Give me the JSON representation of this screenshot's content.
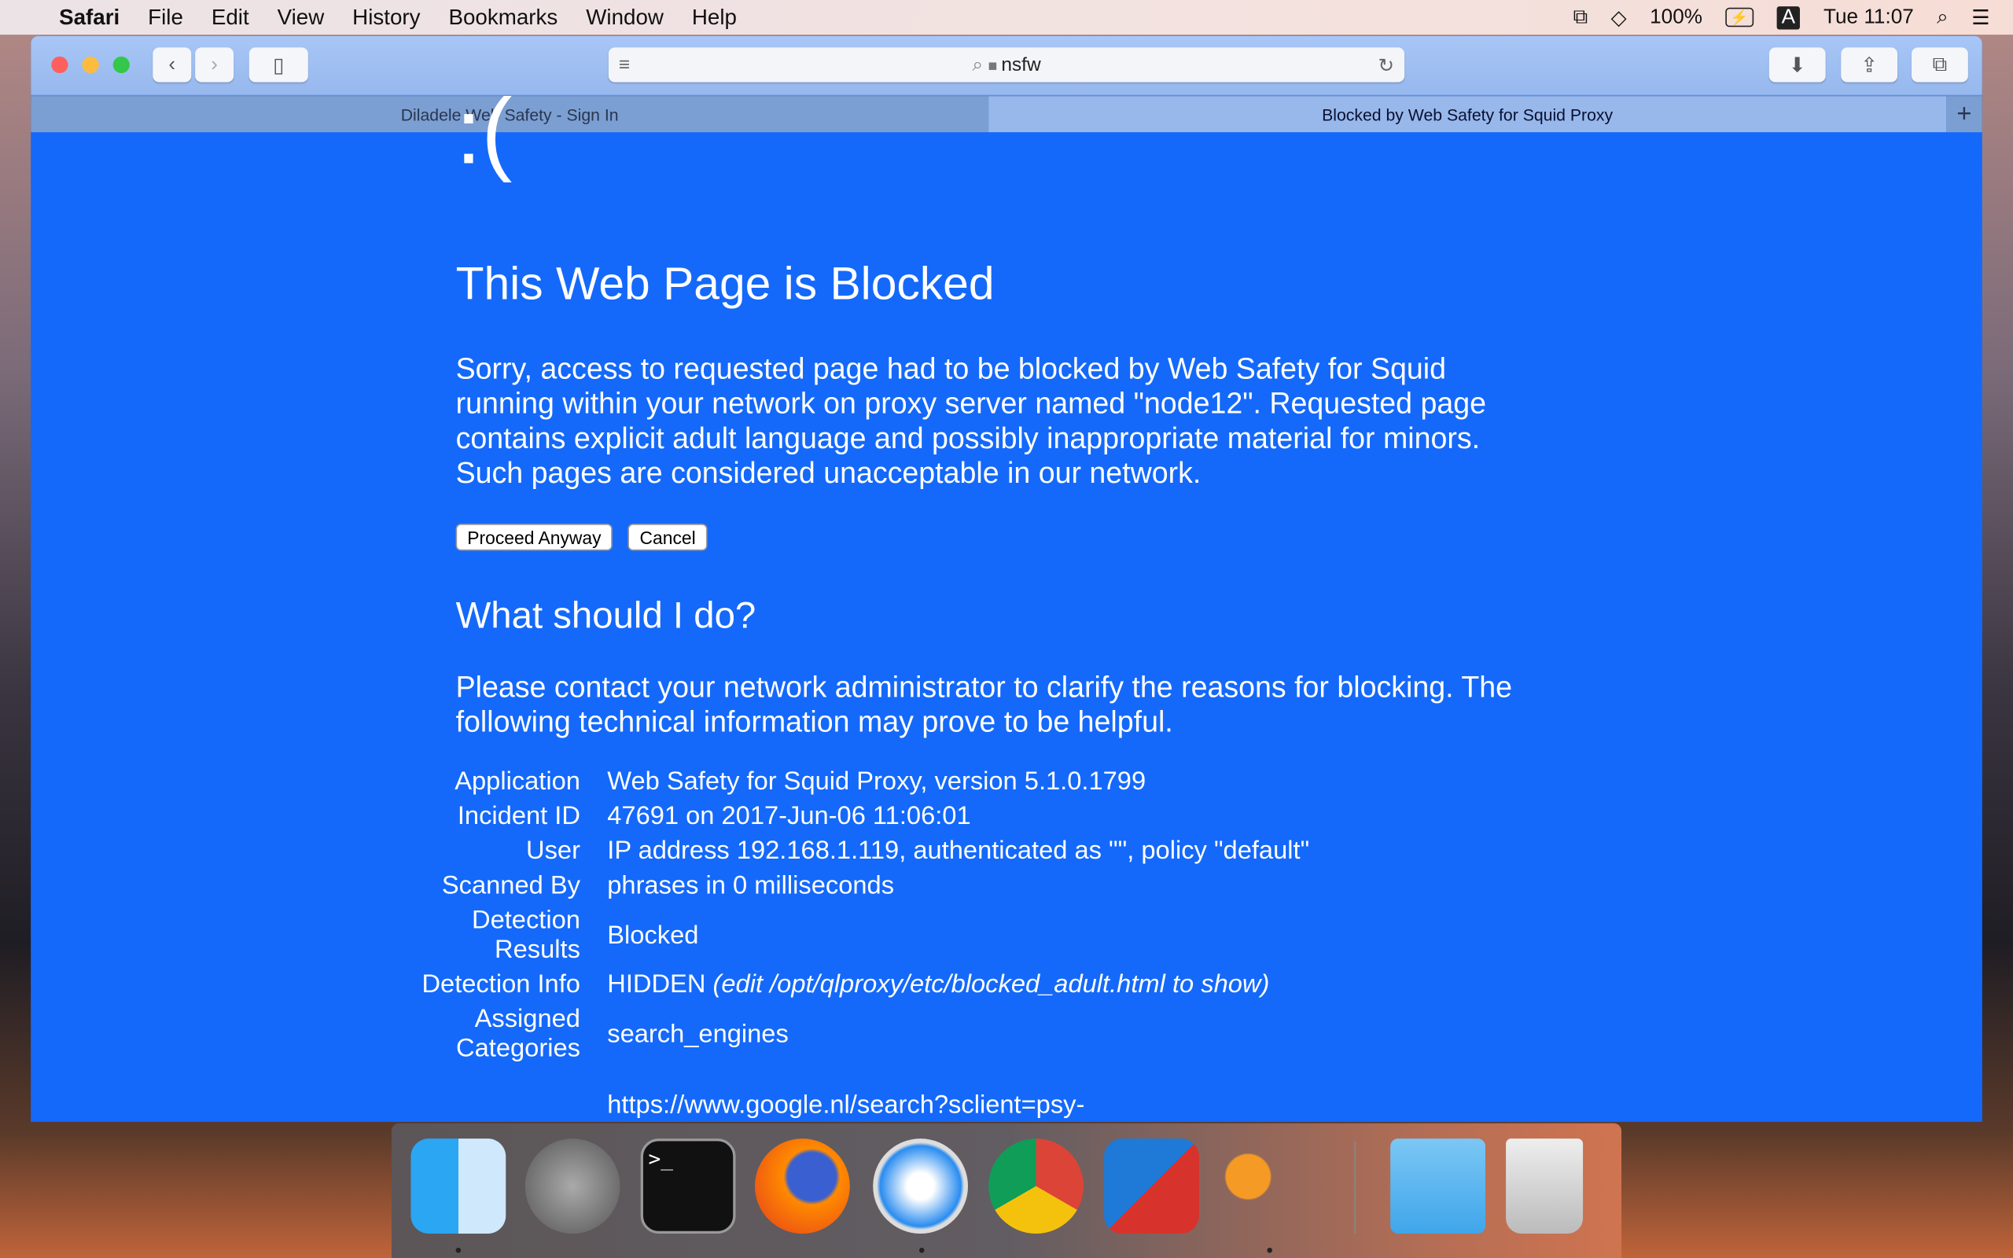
{
  "menubar": {
    "app": "Safari",
    "items": [
      "File",
      "Edit",
      "View",
      "History",
      "Bookmarks",
      "Window",
      "Help"
    ],
    "battery": "100%",
    "input_source": "A",
    "clock": "Tue 11:07"
  },
  "browser": {
    "url": "nsfw",
    "tabs": [
      {
        "title": "Diladele Web Safety - Sign In",
        "active": false
      },
      {
        "title": "Blocked by Web Safety for Squid Proxy",
        "active": true
      }
    ],
    "new_tab": "+"
  },
  "page": {
    "face": ":(",
    "title": "This Web Page is Blocked",
    "message": "Sorry, access to requested page had to be blocked by Web Safety for Squid running within your network on proxy server named \"node12\". Requested page contains explicit adult language and possibly inappropriate material for minors. Such pages are considered unacceptable in our network.",
    "proceed_label": "Proceed Anyway",
    "cancel_label": "Cancel",
    "subtitle": "What should I do?",
    "advice": "Please contact your network administrator to clarify the reasons for blocking. The following technical information may prove to be helpful.",
    "details": [
      {
        "key": "Application",
        "value": "Web Safety for Squid Proxy, version 5.1.0.1799"
      },
      {
        "key": "Incident ID",
        "value": "47691 on 2017-Jun-06 11:06:01"
      },
      {
        "key": "User",
        "value": "IP address 192.168.1.119, authenticated as \"\", policy \"default\""
      },
      {
        "key": "Scanned By",
        "value": "phrases in 0 milliseconds"
      },
      {
        "key": "Detection Results",
        "value": "Blocked"
      },
      {
        "key": "Detection Info",
        "value": "HIDDEN",
        "note": "(edit /opt/qlproxy/etc/blocked_adult.html to show)"
      },
      {
        "key": "Assigned Categories",
        "value": "search_engines"
      },
      {
        "key": "",
        "value": "https://www.google.nl/search?sclient=psy-"
      }
    ]
  },
  "dock": {
    "apps": [
      "Finder",
      "Launchpad",
      "Terminal",
      "Firefox",
      "Safari",
      "Chrome",
      "VMware Fusion",
      "Keychain Access",
      "Downloads",
      "Trash"
    ]
  },
  "colors": {
    "page_bg": "#1469fb",
    "toolbar": "#a8c6f6"
  }
}
